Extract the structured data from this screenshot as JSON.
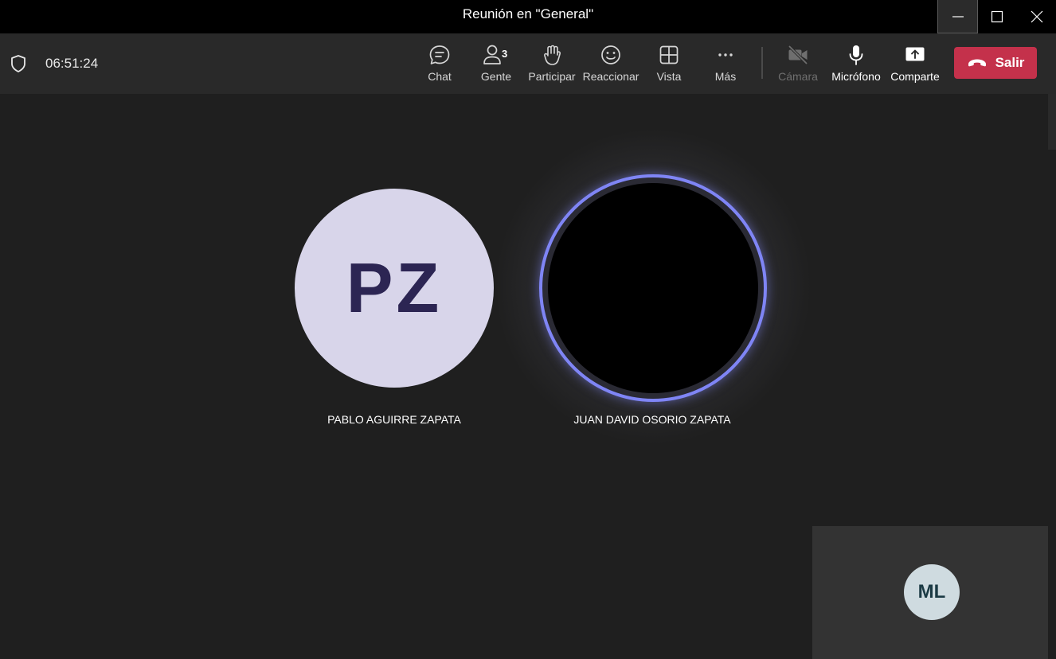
{
  "window": {
    "title": "Reunión en \"General\""
  },
  "toolbar": {
    "timer": "06:51:24",
    "chat_label": "Chat",
    "people_label": "Gente",
    "people_count": "3",
    "raise_hand_label": "Participar",
    "react_label": "Reaccionar",
    "view_label": "Vista",
    "more_label": "Más",
    "camera_label": "Cámara",
    "mic_label": "Micrófono",
    "share_label": "Comparte",
    "leave_label": "Salir"
  },
  "participants": [
    {
      "initials": "PZ",
      "name": "PABLO AGUIRRE ZAPATA"
    },
    {
      "initials": "",
      "name": "JUAN DAVID OSORIO ZAPATA",
      "speaking": true
    }
  ],
  "self_view": {
    "initials": "ML"
  },
  "colors": {
    "background": "#1f1f1f",
    "toolbar": "#292929",
    "leave_button": "#c4314b",
    "speaking_ring": "#7f85f5",
    "avatar_pz": "#d8d5ea",
    "avatar_ml": "#cfdbe0"
  }
}
